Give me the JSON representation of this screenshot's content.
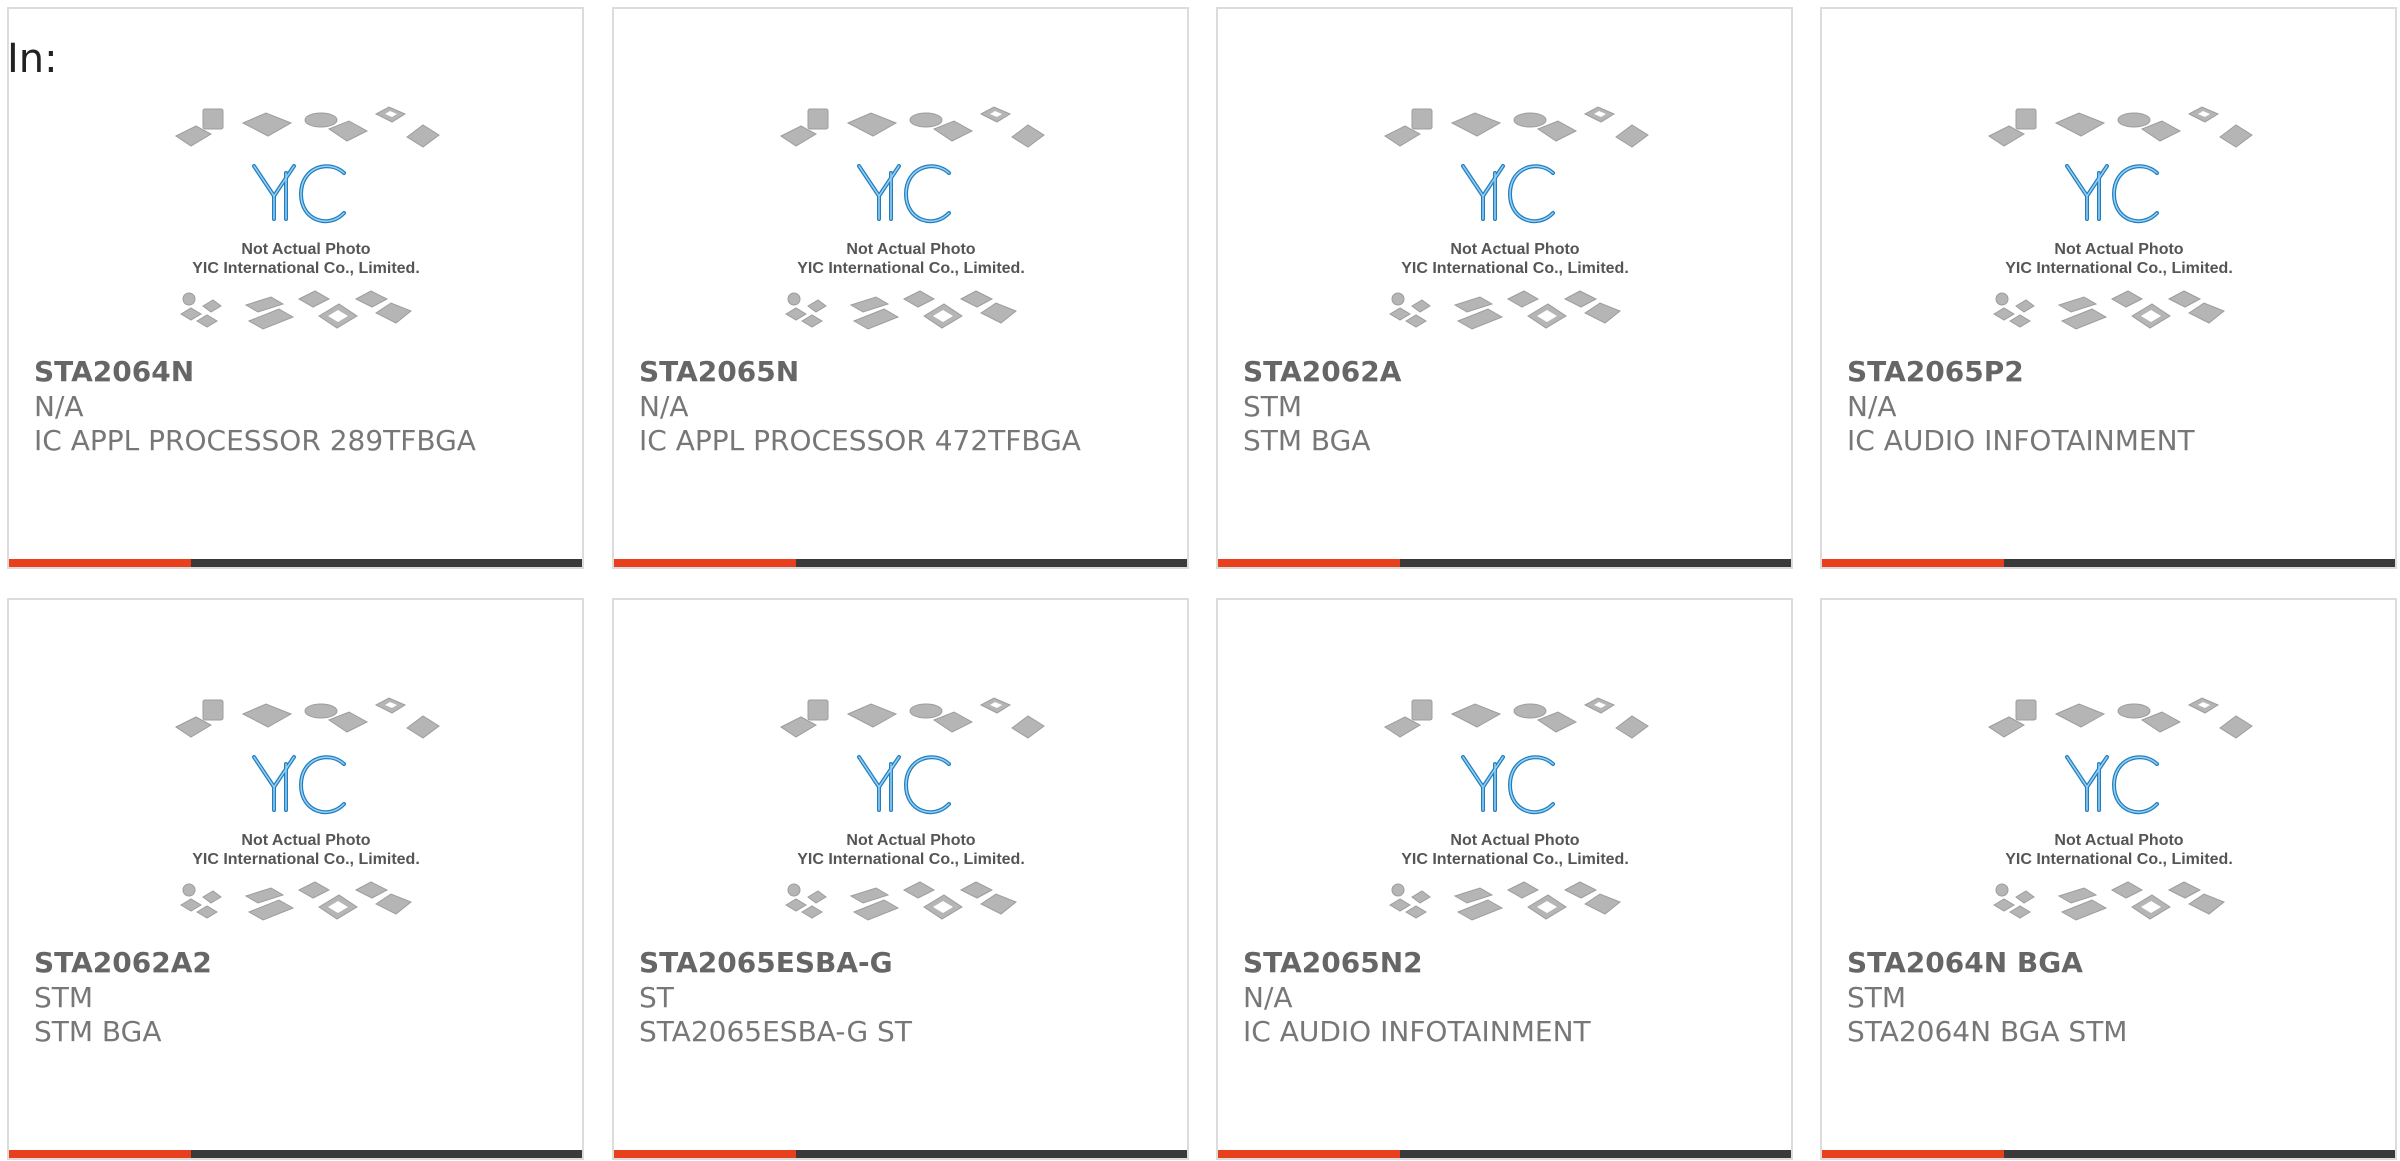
{
  "header": {
    "label": "In:"
  },
  "colors": {
    "accent": "#e8401c",
    "bar": "#3a3a3a",
    "logo_blue": "#1f7fc2"
  },
  "placeholder": {
    "line1": "Not Actual Photo",
    "line2": "YIC International Co., Limited.",
    "logo_text": "YIC"
  },
  "products": [
    {
      "part": "STA2064N",
      "maker": "N/A",
      "desc": "IC APPL PROCESSOR 289TFBGA"
    },
    {
      "part": "STA2065N",
      "maker": "N/A",
      "desc": "IC APPL PROCESSOR 472TFBGA"
    },
    {
      "part": "STA2062A",
      "maker": "STM",
      "desc": "STM BGA"
    },
    {
      "part": "STA2065P2",
      "maker": "N/A",
      "desc": "IC AUDIO INFOTAINMENT"
    },
    {
      "part": "STA2062A2",
      "maker": "STM",
      "desc": "STM BGA"
    },
    {
      "part": "STA2065ESBA-G",
      "maker": "ST",
      "desc": "STA2065ESBA-G ST"
    },
    {
      "part": "STA2065N2",
      "maker": "N/A",
      "desc": "IC AUDIO INFOTAINMENT"
    },
    {
      "part": "STA2064N BGA",
      "maker": "STM",
      "desc": "STA2064N BGA STM"
    }
  ]
}
